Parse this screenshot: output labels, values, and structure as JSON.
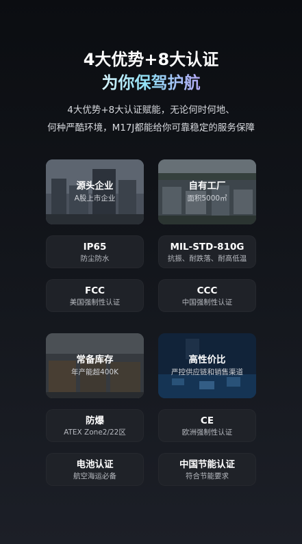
{
  "header": {
    "title_line1": "4大优势+8大认证",
    "title_line2": "为你保驾护航",
    "desc_line1": "4大优势+8大认证赋能，无论何时何地、",
    "desc_line2": "何种严酷环境，M17J都能给你可靠稳定的服务保障"
  },
  "group1": {
    "advantages": [
      {
        "title": "源头企业",
        "sub": "A股上市企业"
      },
      {
        "title": "自有工厂",
        "sub": "面积5000㎡"
      }
    ],
    "certs": [
      {
        "title": "IP65",
        "sub": "防尘防水"
      },
      {
        "title": "MIL-STD-810G",
        "sub": "抗振、耐跌落、耐高低温"
      },
      {
        "title": "FCC",
        "sub": "美国强制性认证"
      },
      {
        "title": "CCC",
        "sub": "中国强制性认证"
      }
    ]
  },
  "group2": {
    "advantages": [
      {
        "title": "常备库存",
        "sub": "年产能超400K"
      },
      {
        "title": "高性价比",
        "sub": "严控供应链和销售渠道"
      }
    ],
    "certs": [
      {
        "title": "防爆",
        "sub": "ATEX Zone2/22区"
      },
      {
        "title": "CE",
        "sub": "欧洲强制性认证"
      },
      {
        "title": "电池认证",
        "sub": "航空海运必备"
      },
      {
        "title": "中国节能认证",
        "sub": "符合节能要求"
      }
    ]
  }
}
